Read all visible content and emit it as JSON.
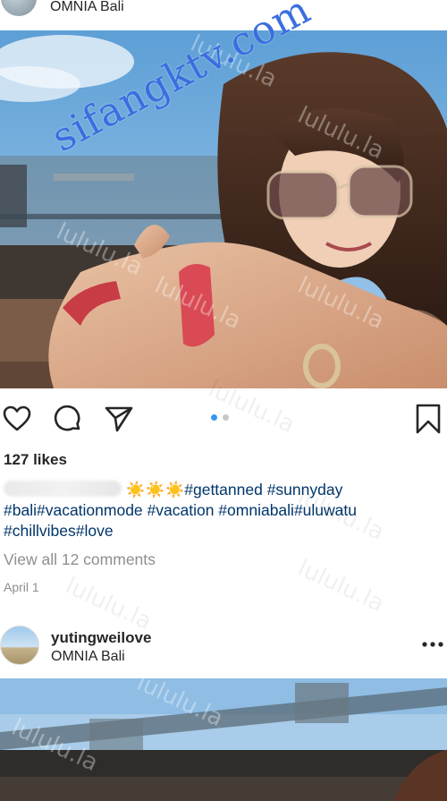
{
  "top_post": {
    "location": "OMNIA Bali"
  },
  "post": {
    "likes": "127 likes",
    "caption": {
      "suns": "☀️☀️☀️",
      "line1_tags": "#gettanned #sunnyday",
      "line2_tags": "#bali#vacationmode #vacation #omniabali#uluwatu",
      "line3_tags": "#chillvibes#love"
    },
    "view_comments": "View all 12 comments",
    "timestamp": "April 1",
    "carousel": {
      "count": 2,
      "active_index": 0
    }
  },
  "next_post": {
    "username": "yutingweilove",
    "location": "OMNIA Bali",
    "more_label": "•••"
  },
  "watermarks": {
    "main": "sifangktv.com",
    "repeat": "lululu.la"
  },
  "icons": {
    "like": "heart-icon",
    "comment": "comment-icon",
    "share": "paper-plane-icon",
    "save": "bookmark-icon",
    "more": "more-dots-icon"
  },
  "colors": {
    "hashtag": "#003569",
    "dot_active": "#3897f0",
    "dot_inactive": "#c7c7c7",
    "muted": "#8e8e8e"
  }
}
